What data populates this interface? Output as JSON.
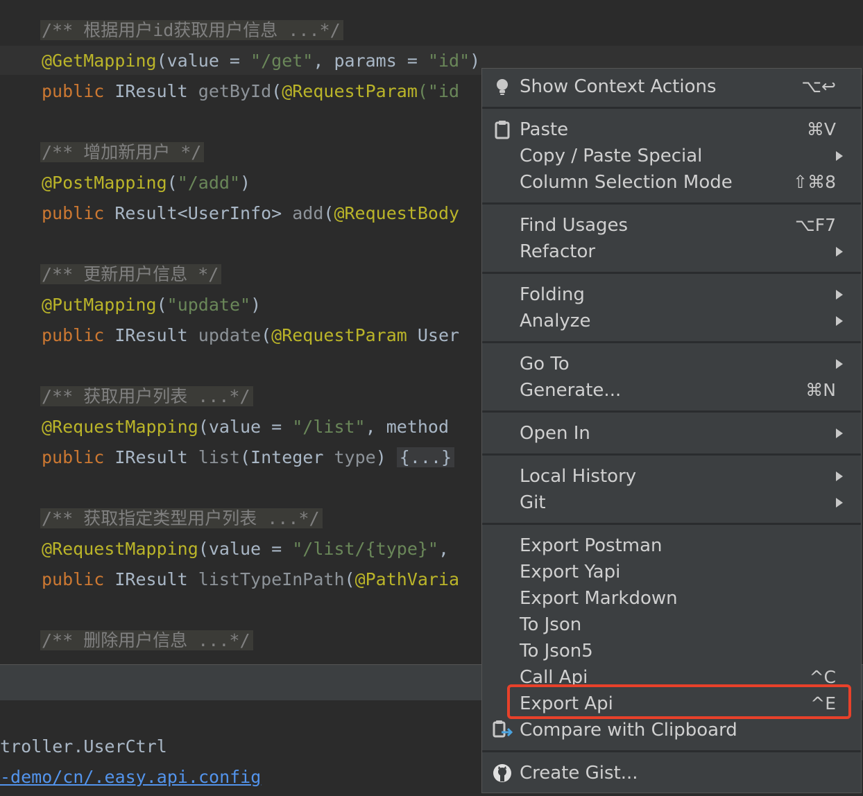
{
  "editor": {
    "lines": [
      {
        "parts": [
          {
            "t": "/** 根据用户id获取用户信息 ...*/",
            "c": "cm doc-bg"
          }
        ]
      },
      {
        "parts": [
          {
            "t": "@GetMapping",
            "c": "an"
          },
          {
            "t": "(value = ",
            "c": "fn"
          },
          {
            "t": "\"/get\"",
            "c": "st"
          },
          {
            "t": ", params = ",
            "c": "fn"
          },
          {
            "t": "\"id\"",
            "c": "st"
          },
          {
            "t": ")",
            "c": "fn"
          }
        ]
      },
      {
        "parts": [
          {
            "t": "public ",
            "c": "kw"
          },
          {
            "t": "IResult ",
            "c": "ty"
          },
          {
            "t": "getById",
            "c": "dim"
          },
          {
            "t": "(",
            "c": "fn"
          },
          {
            "t": "@RequestParam",
            "c": "an"
          },
          {
            "t": "(\"id",
            "c": "st"
          }
        ]
      },
      {
        "parts": [
          {
            "t": "/** 增加新用户 */",
            "c": "cm doc-bg"
          }
        ]
      },
      {
        "parts": [
          {
            "t": "@PostMapping",
            "c": "an"
          },
          {
            "t": "(",
            "c": "fn"
          },
          {
            "t": "\"/add\"",
            "c": "st"
          },
          {
            "t": ")",
            "c": "fn"
          }
        ]
      },
      {
        "parts": [
          {
            "t": "public ",
            "c": "kw"
          },
          {
            "t": "Result<UserInfo> ",
            "c": "ty"
          },
          {
            "t": "add",
            "c": "dim"
          },
          {
            "t": "(",
            "c": "fn"
          },
          {
            "t": "@RequestBody",
            "c": "an"
          }
        ]
      },
      {
        "parts": [
          {
            "t": "/** 更新用户信息 */",
            "c": "cm doc-bg"
          }
        ]
      },
      {
        "parts": [
          {
            "t": "@PutMapping",
            "c": "an"
          },
          {
            "t": "(",
            "c": "fn"
          },
          {
            "t": "\"update\"",
            "c": "st"
          },
          {
            "t": ")",
            "c": "fn"
          }
        ]
      },
      {
        "parts": [
          {
            "t": "public ",
            "c": "kw"
          },
          {
            "t": "IResult ",
            "c": "ty"
          },
          {
            "t": "update",
            "c": "dim"
          },
          {
            "t": "(",
            "c": "fn"
          },
          {
            "t": "@RequestParam",
            "c": "an"
          },
          {
            "t": " User",
            "c": "ty"
          }
        ]
      },
      {
        "parts": [
          {
            "t": "/** 获取用户列表 ...*/",
            "c": "cm doc-bg"
          }
        ]
      },
      {
        "parts": [
          {
            "t": "@RequestMapping",
            "c": "an"
          },
          {
            "t": "(value = ",
            "c": "fn"
          },
          {
            "t": "\"/list\"",
            "c": "st"
          },
          {
            "t": ", method",
            "c": "fn"
          }
        ]
      },
      {
        "parts": [
          {
            "t": "public ",
            "c": "kw"
          },
          {
            "t": "IResult ",
            "c": "ty"
          },
          {
            "t": "list",
            "c": "dim"
          },
          {
            "t": "(Integer ",
            "c": "fn"
          },
          {
            "t": "type",
            "c": "dim"
          },
          {
            "t": ") ",
            "c": "fn"
          },
          {
            "t": "{...}",
            "c": "fold"
          }
        ]
      },
      {
        "parts": [
          {
            "t": "/** 获取指定类型用户列表 ...*/",
            "c": "cm doc-bg"
          }
        ]
      },
      {
        "parts": [
          {
            "t": "@RequestMapping",
            "c": "an"
          },
          {
            "t": "(value = ",
            "c": "fn"
          },
          {
            "t": "\"/list/{type}\"",
            "c": "st"
          },
          {
            "t": ",",
            "c": "fn"
          }
        ]
      },
      {
        "parts": [
          {
            "t": "public ",
            "c": "kw"
          },
          {
            "t": "IResult ",
            "c": "ty"
          },
          {
            "t": "listTypeInPath",
            "c": "dim"
          },
          {
            "t": "(",
            "c": "fn"
          },
          {
            "t": "@PathVaria",
            "c": "an"
          }
        ]
      },
      {
        "parts": [
          {
            "t": "/** 删除用户信息 ...*/",
            "c": "cm doc-bg"
          }
        ]
      }
    ]
  },
  "console": {
    "line1": "troller.UserCtrl",
    "line2": "-demo/cn/.easy.api.config"
  },
  "menu": {
    "items": [
      {
        "label": "Show Context Actions",
        "shortcut": "⌥↩",
        "icon": "lightbulb-icon"
      },
      {
        "label": "Paste",
        "shortcut": "⌘V",
        "icon": "clipboard-icon"
      },
      {
        "label": "Copy / Paste Special",
        "submenu": true
      },
      {
        "label": "Column Selection Mode",
        "shortcut": "⇧⌘8"
      },
      {
        "label": "Find Usages",
        "shortcut": "⌥F7"
      },
      {
        "label": "Refactor",
        "submenu": true
      },
      {
        "label": "Folding",
        "submenu": true
      },
      {
        "label": "Analyze",
        "submenu": true
      },
      {
        "label": "Go To",
        "submenu": true
      },
      {
        "label": "Generate...",
        "shortcut": "⌘N"
      },
      {
        "label": "Open In",
        "submenu": true
      },
      {
        "label": "Local History",
        "submenu": true
      },
      {
        "label": "Git",
        "submenu": true
      },
      {
        "label": "Export Postman"
      },
      {
        "label": "Export Yapi"
      },
      {
        "label": "Export Markdown"
      },
      {
        "label": "To Json"
      },
      {
        "label": "To Json5"
      },
      {
        "label": "Call Api",
        "shortcut": "^C"
      },
      {
        "label": "Export Api",
        "shortcut": "^E",
        "highlighted": true
      },
      {
        "label": "Compare with Clipboard",
        "icon": "compare-clipboard-icon"
      },
      {
        "label": "Create Gist...",
        "icon": "github-icon"
      }
    ]
  },
  "colors": {
    "highlight_border": "#e8412a",
    "menu_bg": "#3c3f41",
    "editor_bg": "#2b2b2b"
  }
}
